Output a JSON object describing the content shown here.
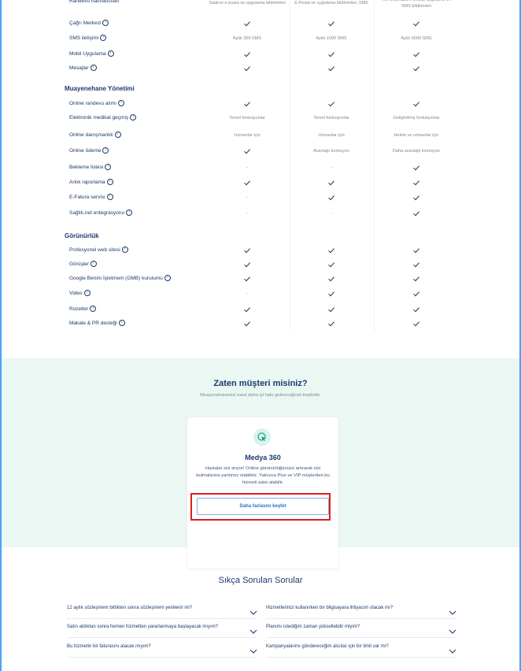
{
  "table": {
    "top_row": {
      "label": "Randevu hatırlatıcıları",
      "cells": [
        "Sadece e-posta ve uygulama bildirimleri",
        "E-Posta ve uygulama bildirimleri, SMS",
        "Tek tıkla toplu e-posta, uygulama ve SMS bildirimleri"
      ]
    },
    "rows_a": [
      {
        "label": "Çağrı Merkezi",
        "cells": [
          "check",
          "check",
          "check"
        ]
      },
      {
        "label": "SMS iletişimi",
        "cells": [
          "Aylık 300 SMS",
          "Aylık 1000 SMS",
          "Aylık 5000 SMS"
        ]
      },
      {
        "label": "Mobil Uygulama",
        "cells": [
          "check",
          "check",
          "check"
        ]
      },
      {
        "label": "Mesajlar",
        "cells": [
          "check",
          "check",
          "check"
        ]
      }
    ],
    "section_management": "Muayenehane Yönetimi",
    "rows_b": [
      {
        "label": "Online randevu alımı",
        "cells": [
          "check",
          "check",
          "check"
        ]
      },
      {
        "label": "Elektronik medikal geçmiş",
        "cells": [
          "Temel fonksiyonlar",
          "Temel fonksiyonlar",
          "Geliştirilmiş fonksiyonlar"
        ]
      },
      {
        "label": "Online danışmanlık",
        "cells": [
          "Uzmanlar için",
          "Uzmanlar için",
          "Hekim ve uzmanlar için"
        ]
      },
      {
        "label": "Online ödeme",
        "cells": [
          "check",
          "Avantajlı komisyon",
          "Daha avantajlı komisyon"
        ]
      },
      {
        "label": "Bekleme listesi",
        "cells": [
          "-",
          "-",
          "check"
        ]
      },
      {
        "label": "Anlık raporlama",
        "cells": [
          "check",
          "check",
          "check"
        ]
      },
      {
        "label": "E-Fatura servisi",
        "cells": [
          "-",
          "check",
          "check"
        ]
      },
      {
        "label": "Sağlık.net entegrasyonu",
        "cells": [
          "-",
          "-",
          "check"
        ]
      }
    ],
    "section_visibility": "Görünürlük",
    "rows_c": [
      {
        "label": "Profesyonel web sitesi",
        "cells": [
          "check",
          "check",
          "check"
        ]
      },
      {
        "label": "Görüşler",
        "cells": [
          "check",
          "check",
          "check"
        ]
      },
      {
        "label": "Google Benim İşletmem (GMB) kurulumu",
        "cells": [
          "check",
          "check",
          "check"
        ]
      },
      {
        "label": "Video",
        "cells": [
          "-",
          "check",
          "check"
        ]
      },
      {
        "label": "Rozetler",
        "cells": [
          "check",
          "check",
          "check"
        ]
      },
      {
        "label": "Makale & PR desteği",
        "cells": [
          "check",
          "check",
          "check"
        ]
      }
    ]
  },
  "customer": {
    "title": "Zaten müşteri misiniz?",
    "subtitle": "Muayenehanenizi nasıl daha iyi hale getireceğinizi keşfedin.",
    "card_icon": "cursor-click-icon",
    "card_title": "Medya 360",
    "card_text": "Hastalar sizi arıyor! Online görünürlüğünüzü artırarak sizi bulmalarına yardımcı olabiliriz. Yalnızca Plus ve VIP müşterileri bu hizmeti satın alabilir.",
    "card_button": "Daha fazlasını keşfet"
  },
  "faq": {
    "title": "Sıkça Sorulan Sorular",
    "left": [
      "12 aylık sözleşmem bittikten sonra sözleşmem yenilenir mi?",
      "Satın aldıktan sonra hemen hizmetten yararlanmaya başlayacak mıyım?",
      "Bu hizmetin bir faturasını alacak mıyım?"
    ],
    "right": [
      "Hizmetlerinizi kullanırken bir bilgisayara ihtiyacım olacak mı?",
      "Planımı istediğim zaman yükseltebilir miyim?",
      "Kampanyalarımı göndereceğim alıcılar için bir limit var mı?"
    ]
  },
  "colors": {
    "accent": "#2f6fc8",
    "navy": "#1b3a6b",
    "mint": "#eaf7f3",
    "highlight": "#e21b1b"
  }
}
